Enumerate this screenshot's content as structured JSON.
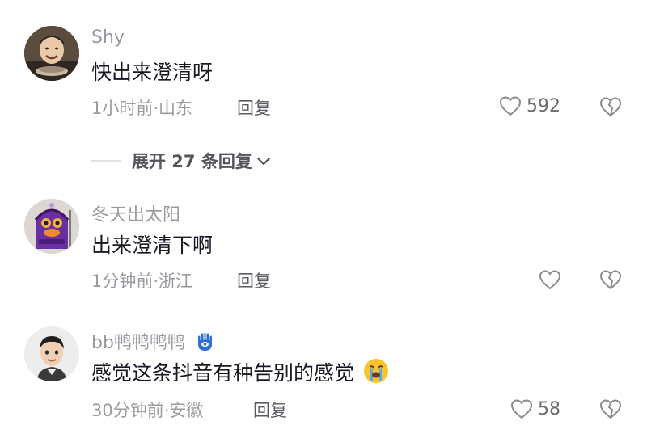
{
  "comments": [
    {
      "username": "Shy",
      "text": "快出来澄清呀",
      "time_location": "1小时前·山东",
      "reply_label": "回复",
      "likes": "592",
      "avatar_icon": "child-photo-avatar",
      "expand_label": "展开 27 条回复"
    },
    {
      "username": "冬天出太阳",
      "text": "出来澄清下啊",
      "time_location": "1分钟前·浙江",
      "reply_label": "回复",
      "likes": "",
      "avatar_icon": "purple-cartoon-avatar"
    },
    {
      "username": "bb鸭鸭鸭鸭",
      "text": "感觉这条抖音有种告别的感觉",
      "time_location": "30分钟前·安徽",
      "reply_label": "回复",
      "likes": "58",
      "avatar_icon": "memoji-avatar",
      "badge_icon": "hamsa-hand-icon",
      "trailing_emoji": "crying-face-emoji"
    }
  ],
  "colors": {
    "text_primary": "#161823",
    "text_secondary": "#9a9ba1",
    "icon_gray": "#8a8b91",
    "badge_blue": "#2f6fd1"
  }
}
